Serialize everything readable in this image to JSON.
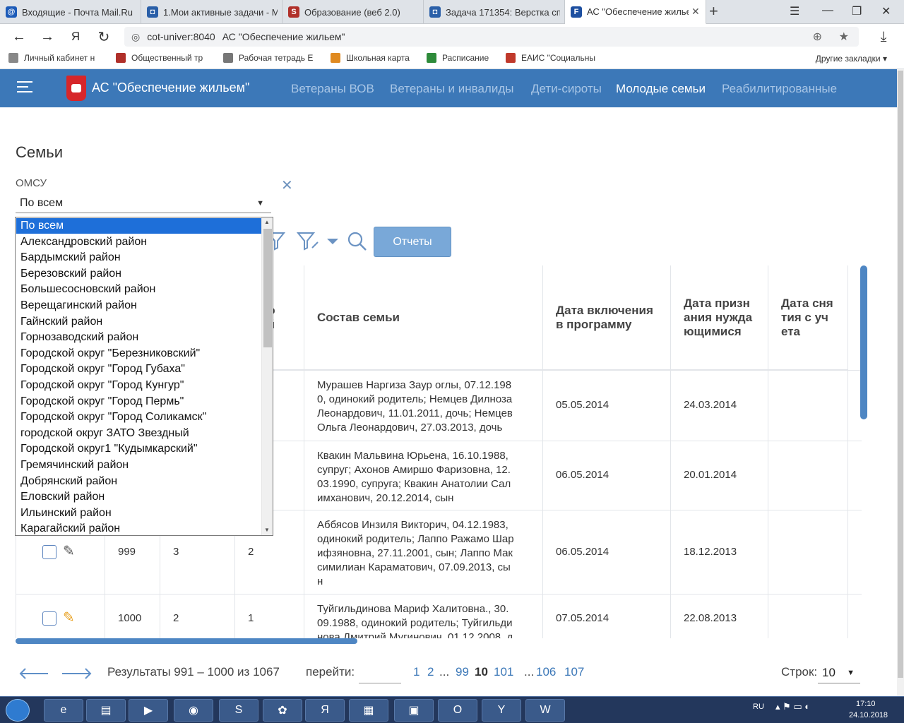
{
  "browser": {
    "tabs": [
      {
        "title": "Входящие - Почта Mail.Ru",
        "icon": "mail-icon",
        "color": "#1c5bb8",
        "letter": "@"
      },
      {
        "title": "1.Мои активные задачи - М",
        "icon": "task-icon",
        "color": "#2a5fa8",
        "letter": "◘"
      },
      {
        "title": "Образование (веб 2.0)",
        "icon": "s-icon",
        "color": "#b0302a",
        "letter": "S"
      },
      {
        "title": "Задача 171354: Верстка спр",
        "icon": "task-icon",
        "color": "#2a5fa8",
        "letter": "◘"
      },
      {
        "title": "АС \"Обеспечение жилье",
        "icon": "f-icon",
        "color": "#1d4fa0",
        "letter": "F"
      }
    ],
    "address": {
      "host": "cot-univer:8040",
      "title": "АС \"Обеспечение жильем\""
    },
    "bookmarks": [
      {
        "label": "Личный кабинет н",
        "color": "#888"
      },
      {
        "label": "Общественный тр",
        "color": "#b0302a"
      },
      {
        "label": "Рабочая тетрадь Е",
        "color": "#777"
      },
      {
        "label": "Школьная карта",
        "color": "#e08a20"
      },
      {
        "label": "Расписание",
        "color": "#2e8b3a"
      },
      {
        "label": "ЕАИС \"Социальны",
        "color": "#c0392b"
      }
    ],
    "other_bookmarks": "Другие закладки"
  },
  "app": {
    "name": "АС \"Обеспечение жильем\"",
    "nav": [
      "Ветераны ВОВ",
      "Ветераны и инвалиды",
      "Дети-сироты",
      "Молодые семьи",
      "Реабилитированные"
    ],
    "active_nav": "Молодые семьи"
  },
  "page": {
    "title": "Семьи",
    "omsu_label": "ОМСУ",
    "omsu_value": "По всем",
    "reports_button": "Отчеты"
  },
  "dropdown": {
    "options": [
      "По всем",
      "Александровский район",
      "Бардымский район",
      "Березовский район",
      "Большесосновский район",
      "Верещагинский район",
      "Гайнский район",
      "Горнозаводский район",
      "Городской округ \"Березниковский\"",
      "Городской округ \"Город Губаха\"",
      "Городской округ \"Город Кунгур\"",
      "Городской округ \"Город Пермь\"",
      "Городской округ \"Город Соликамск\"",
      "городской округ ЗАТО Звездный",
      "Городской округ1 \"Кудымкарский\"",
      "Гремячинский район",
      "Добрянский район",
      "Еловский район",
      "Ильинский район",
      "Карагайский район"
    ],
    "selected_index": 0
  },
  "table": {
    "headers": {
      "partial": [
        "во",
        "ей"
      ],
      "family": "Состав семьи",
      "date_include": [
        "Дата включения",
        "в программу"
      ],
      "date_need": [
        "Дата призн",
        "ания нужда",
        "ющимися"
      ],
      "date_remove": [
        "Дата сня",
        "тия с уч",
        "ета"
      ]
    },
    "rows": [
      {
        "num": "",
        "c2": "",
        "c3": "",
        "family": [
          "Мурашев Наргиза Заур оглы, 07.12.198",
          "0, одинокий родитель; Немцев Дилноза",
          "Леонардович, 11.01.2011, дочь; Немцев",
          "Ольга Леонардович, 27.03.2013, дочь"
        ],
        "date_include": "05.05.2014",
        "date_need": "24.03.2014",
        "date_remove": ""
      },
      {
        "num": "",
        "c2": "",
        "c3": "",
        "family": [
          "Квакин Мальвина Юрьена, 16.10.1988,",
          "супруг; Ахонов Амиршо Фаризовна, 12.",
          "03.1990, супруга; Квакин Анатолии Сал",
          "имханович, 20.12.2014, сын"
        ],
        "date_include": "06.05.2014",
        "date_need": "20.01.2014",
        "date_remove": ""
      },
      {
        "num": "999",
        "c2": "3",
        "c3": "2",
        "family": [
          "Аббясов Инзиля Викторич, 04.12.1983,",
          "одинокий родитель; Лаппо Ражамо Шар",
          "ифзяновна, 27.11.2001, сын; Лаппо Мак",
          "симилиан Караматович, 07.09.2013, сы",
          "н"
        ],
        "date_include": "06.05.2014",
        "date_need": "18.12.2013",
        "date_remove": ""
      },
      {
        "num": "1000",
        "c2": "2",
        "c3": "1",
        "family": [
          "Туйгильдинова Мариф Халитовна., 30.",
          "09.1988, одинокий родитель; Туйгильди",
          "нова Дмитрий Мугинович, 01.12.2008, д"
        ],
        "date_include": "07.05.2014",
        "date_need": "22.08.2013",
        "date_remove": ""
      }
    ]
  },
  "pager": {
    "results": "Результаты 991 – 1000 из 1067",
    "goto_label": "перейти:",
    "pages": [
      "1",
      "2",
      "...",
      "99",
      "10",
      "101",
      "...",
      "106",
      "107"
    ],
    "current_page": "10",
    "rows_label": "Строк:",
    "rows_value": "10"
  },
  "taskbar": {
    "lang": "RU",
    "time": "17:10",
    "date": "24.10.2018"
  }
}
